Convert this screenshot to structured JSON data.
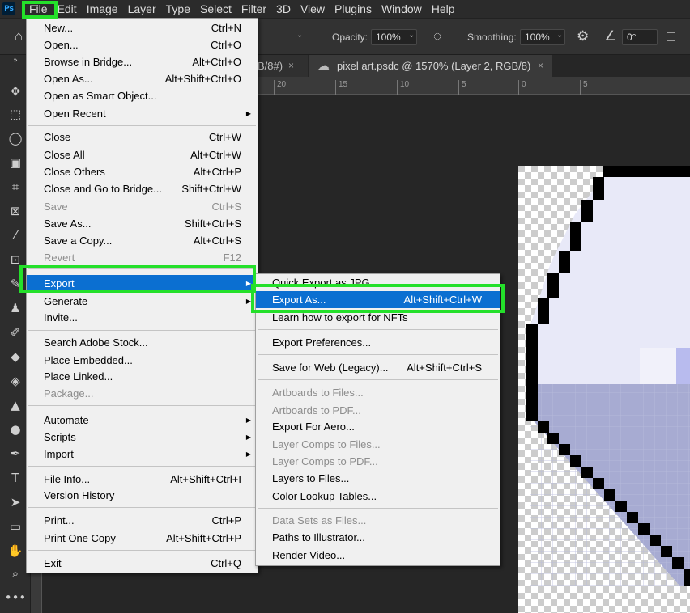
{
  "menubar": {
    "logo": "Ps",
    "items": [
      "File",
      "Edit",
      "Image",
      "Layer",
      "Type",
      "Select",
      "Filter",
      "3D",
      "View",
      "Plugins",
      "Window",
      "Help"
    ]
  },
  "options": {
    "opacity_label": "Opacity:",
    "opacity_value": "100%",
    "smoothing_label": "Smoothing:",
    "smoothing_value": "100%",
    "angle_value": "0°"
  },
  "tabs": {
    "partial_tab": "B/8#)",
    "active_tab": "pixel art.psdc @ 1570% (Layer 2, RGB/8)",
    "close_glyph": "×"
  },
  "ruler_ticks": [
    "20",
    "15",
    "10",
    "5",
    "0",
    "5"
  ],
  "file_menu": {
    "items": [
      {
        "label": "New...",
        "shortcut": "Ctrl+N"
      },
      {
        "label": "Open...",
        "shortcut": "Ctrl+O"
      },
      {
        "label": "Browse in Bridge...",
        "shortcut": "Alt+Ctrl+O"
      },
      {
        "label": "Open As...",
        "shortcut": "Alt+Shift+Ctrl+O"
      },
      {
        "label": "Open as Smart Object...",
        "shortcut": ""
      },
      {
        "label": "Open Recent",
        "shortcut": ""
      },
      {
        "label": "Close",
        "shortcut": "Ctrl+W"
      },
      {
        "label": "Close All",
        "shortcut": "Alt+Ctrl+W"
      },
      {
        "label": "Close Others",
        "shortcut": "Alt+Ctrl+P"
      },
      {
        "label": "Close and Go to Bridge...",
        "shortcut": "Shift+Ctrl+W"
      },
      {
        "label": "Save",
        "shortcut": "Ctrl+S"
      },
      {
        "label": "Save As...",
        "shortcut": "Shift+Ctrl+S"
      },
      {
        "label": "Save a Copy...",
        "shortcut": "Alt+Ctrl+S"
      },
      {
        "label": "Revert",
        "shortcut": "F12"
      },
      {
        "label": "Export",
        "shortcut": ""
      },
      {
        "label": "Generate",
        "shortcut": ""
      },
      {
        "label": "Invite...",
        "shortcut": ""
      },
      {
        "label": "Search Adobe Stock...",
        "shortcut": ""
      },
      {
        "label": "Place Embedded...",
        "shortcut": ""
      },
      {
        "label": "Place Linked...",
        "shortcut": ""
      },
      {
        "label": "Package...",
        "shortcut": ""
      },
      {
        "label": "Automate",
        "shortcut": ""
      },
      {
        "label": "Scripts",
        "shortcut": ""
      },
      {
        "label": "Import",
        "shortcut": ""
      },
      {
        "label": "File Info...",
        "shortcut": "Alt+Shift+Ctrl+I"
      },
      {
        "label": "Version History",
        "shortcut": ""
      },
      {
        "label": "Print...",
        "shortcut": "Ctrl+P"
      },
      {
        "label": "Print One Copy",
        "shortcut": "Alt+Shift+Ctrl+P"
      },
      {
        "label": "Exit",
        "shortcut": "Ctrl+Q"
      }
    ]
  },
  "export_menu": {
    "items": [
      {
        "label": "Quick Export as JPG",
        "shortcut": ""
      },
      {
        "label": "Export As...",
        "shortcut": "Alt+Shift+Ctrl+W"
      },
      {
        "label": "Learn how to export for NFTs",
        "shortcut": ""
      },
      {
        "label": "Export Preferences...",
        "shortcut": ""
      },
      {
        "label": "Save for Web (Legacy)...",
        "shortcut": "Alt+Shift+Ctrl+S"
      },
      {
        "label": "Artboards to Files...",
        "shortcut": ""
      },
      {
        "label": "Artboards to PDF...",
        "shortcut": ""
      },
      {
        "label": "Export For Aero...",
        "shortcut": ""
      },
      {
        "label": "Layer Comps to Files...",
        "shortcut": ""
      },
      {
        "label": "Layer Comps to PDF...",
        "shortcut": ""
      },
      {
        "label": "Layers to Files...",
        "shortcut": ""
      },
      {
        "label": "Color Lookup Tables...",
        "shortcut": ""
      },
      {
        "label": "Data Sets as Files...",
        "shortcut": ""
      },
      {
        "label": "Paths to Illustrator...",
        "shortcut": ""
      },
      {
        "label": "Render Video...",
        "shortcut": ""
      }
    ]
  },
  "colors": {
    "highlight_green": "#24e02a",
    "menu_selection_blue": "#0b6fd1"
  }
}
